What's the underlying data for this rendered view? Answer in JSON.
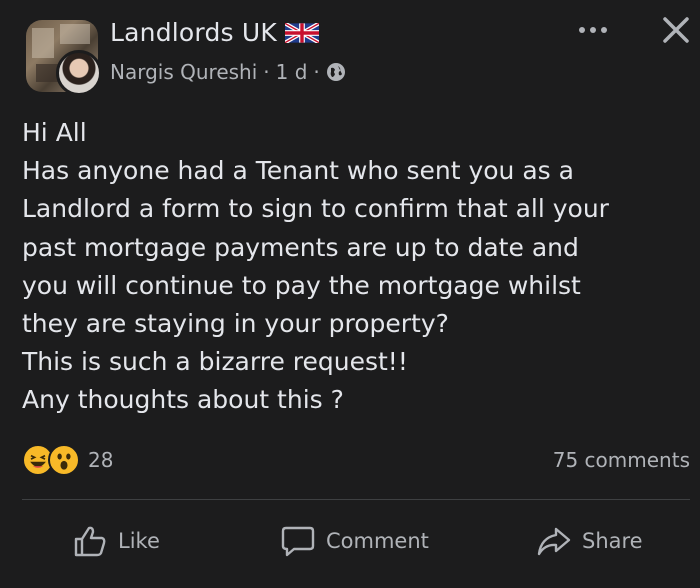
{
  "post": {
    "group_name": "Landlords UK",
    "author": "Nargis Qureshi",
    "separator": "·",
    "time": "1 d",
    "body": "Hi All\nHas anyone had a Tenant who sent you as a\nLandlord a form to sign to confirm that all your\npast mortgage payments are up to date and\nyou will continue to pay the mortgage whilst\nthey are staying in your property?\nThis is such a bizarre request!!\nAny thoughts about this ?",
    "reaction_count": "28",
    "comments_count": "75 comments",
    "reactions": [
      "laughing-face",
      "surprised-face"
    ]
  },
  "actions": {
    "like_label": "Like",
    "comment_label": "Comment",
    "share_label": "Share"
  },
  "colors": {
    "background": "#1c1c1d",
    "text_primary": "#e4e6eb",
    "text_secondary": "#b0b3b8",
    "reaction_yellow": "#f7b928"
  }
}
